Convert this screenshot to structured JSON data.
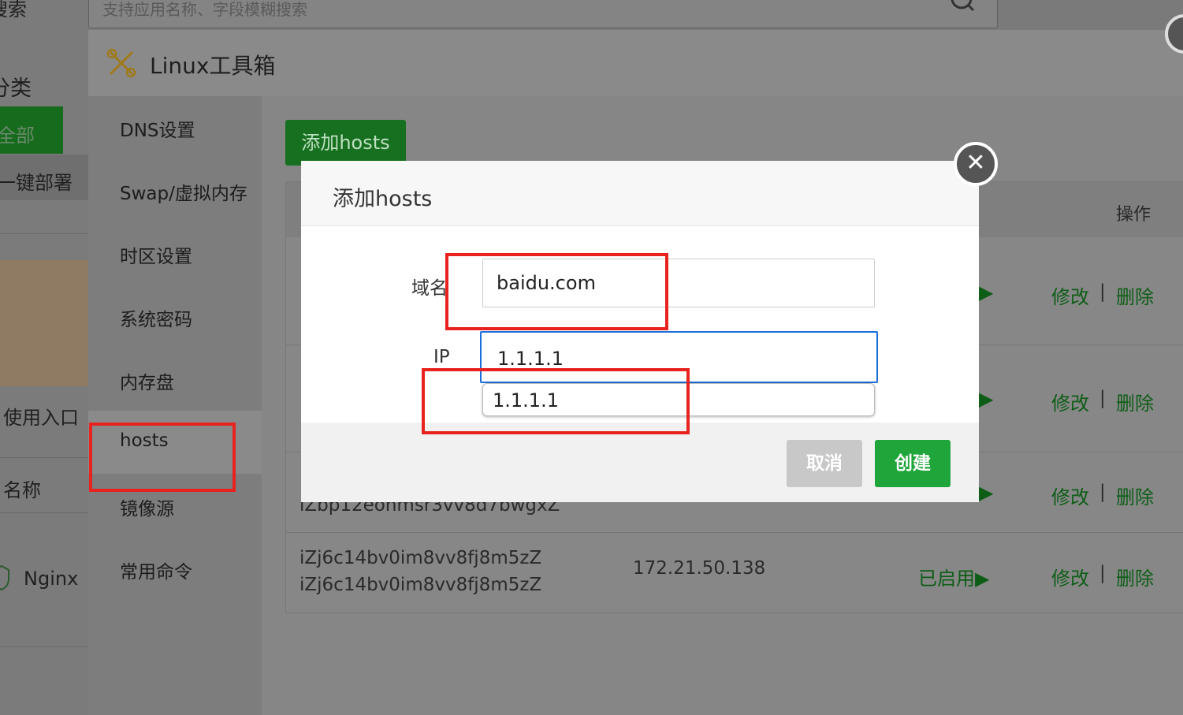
{
  "background": {
    "search_placeholder": "支持应用名称、字段模糊搜索",
    "search_label": "搜索",
    "category_heading": "分类",
    "categories": [
      "全部",
      "一键部署"
    ],
    "recent_label": "使用入口",
    "name_label": "名称",
    "plugin_label": "Nginx"
  },
  "toolbox": {
    "title": "Linux工具箱",
    "sidebar": [
      "DNS设置",
      "Swap/虚拟内存",
      "时区设置",
      "系统密码",
      "内存盘",
      "hosts",
      "镜像源",
      "常用命令"
    ],
    "add_button": "添加hosts",
    "table_header_op": "操作",
    "rows": [
      {
        "name1": "",
        "name2": "",
        "ip": "",
        "status": "",
        "edit": "修改",
        "sep": "|",
        "delete": "删除"
      },
      {
        "name1": "",
        "name2": "",
        "ip": "",
        "status": "",
        "edit": "修改",
        "sep": "|",
        "delete": "删除"
      },
      {
        "name1": "iZbp12eonmsr3vv8d7bwgxZ",
        "name2": "",
        "ip": "",
        "status": "",
        "edit": "修改",
        "sep": "|",
        "delete": "删除"
      },
      {
        "name1": "iZj6c14bv0im8vv8fj8m5zZ",
        "name2": "iZj6c14bv0im8vv8fj8m5zZ",
        "ip": "172.21.50.138",
        "status": "已启用▶",
        "edit": "修改",
        "sep": "|",
        "delete": "删除"
      }
    ]
  },
  "dialog": {
    "title": "添加hosts",
    "domain_label": "域名",
    "domain_value": "baidu.com",
    "ip_label": "IP",
    "ip_value": "1.1.1.1",
    "autocomplete_suggestion": "1.1.1.1",
    "cancel_label": "取消",
    "create_label": "创建",
    "close_glyph": "✕"
  },
  "colors": {
    "accent_green": "#20a53a",
    "focus_blue": "#1a6fdc",
    "annotation_red": "#e8231f"
  }
}
